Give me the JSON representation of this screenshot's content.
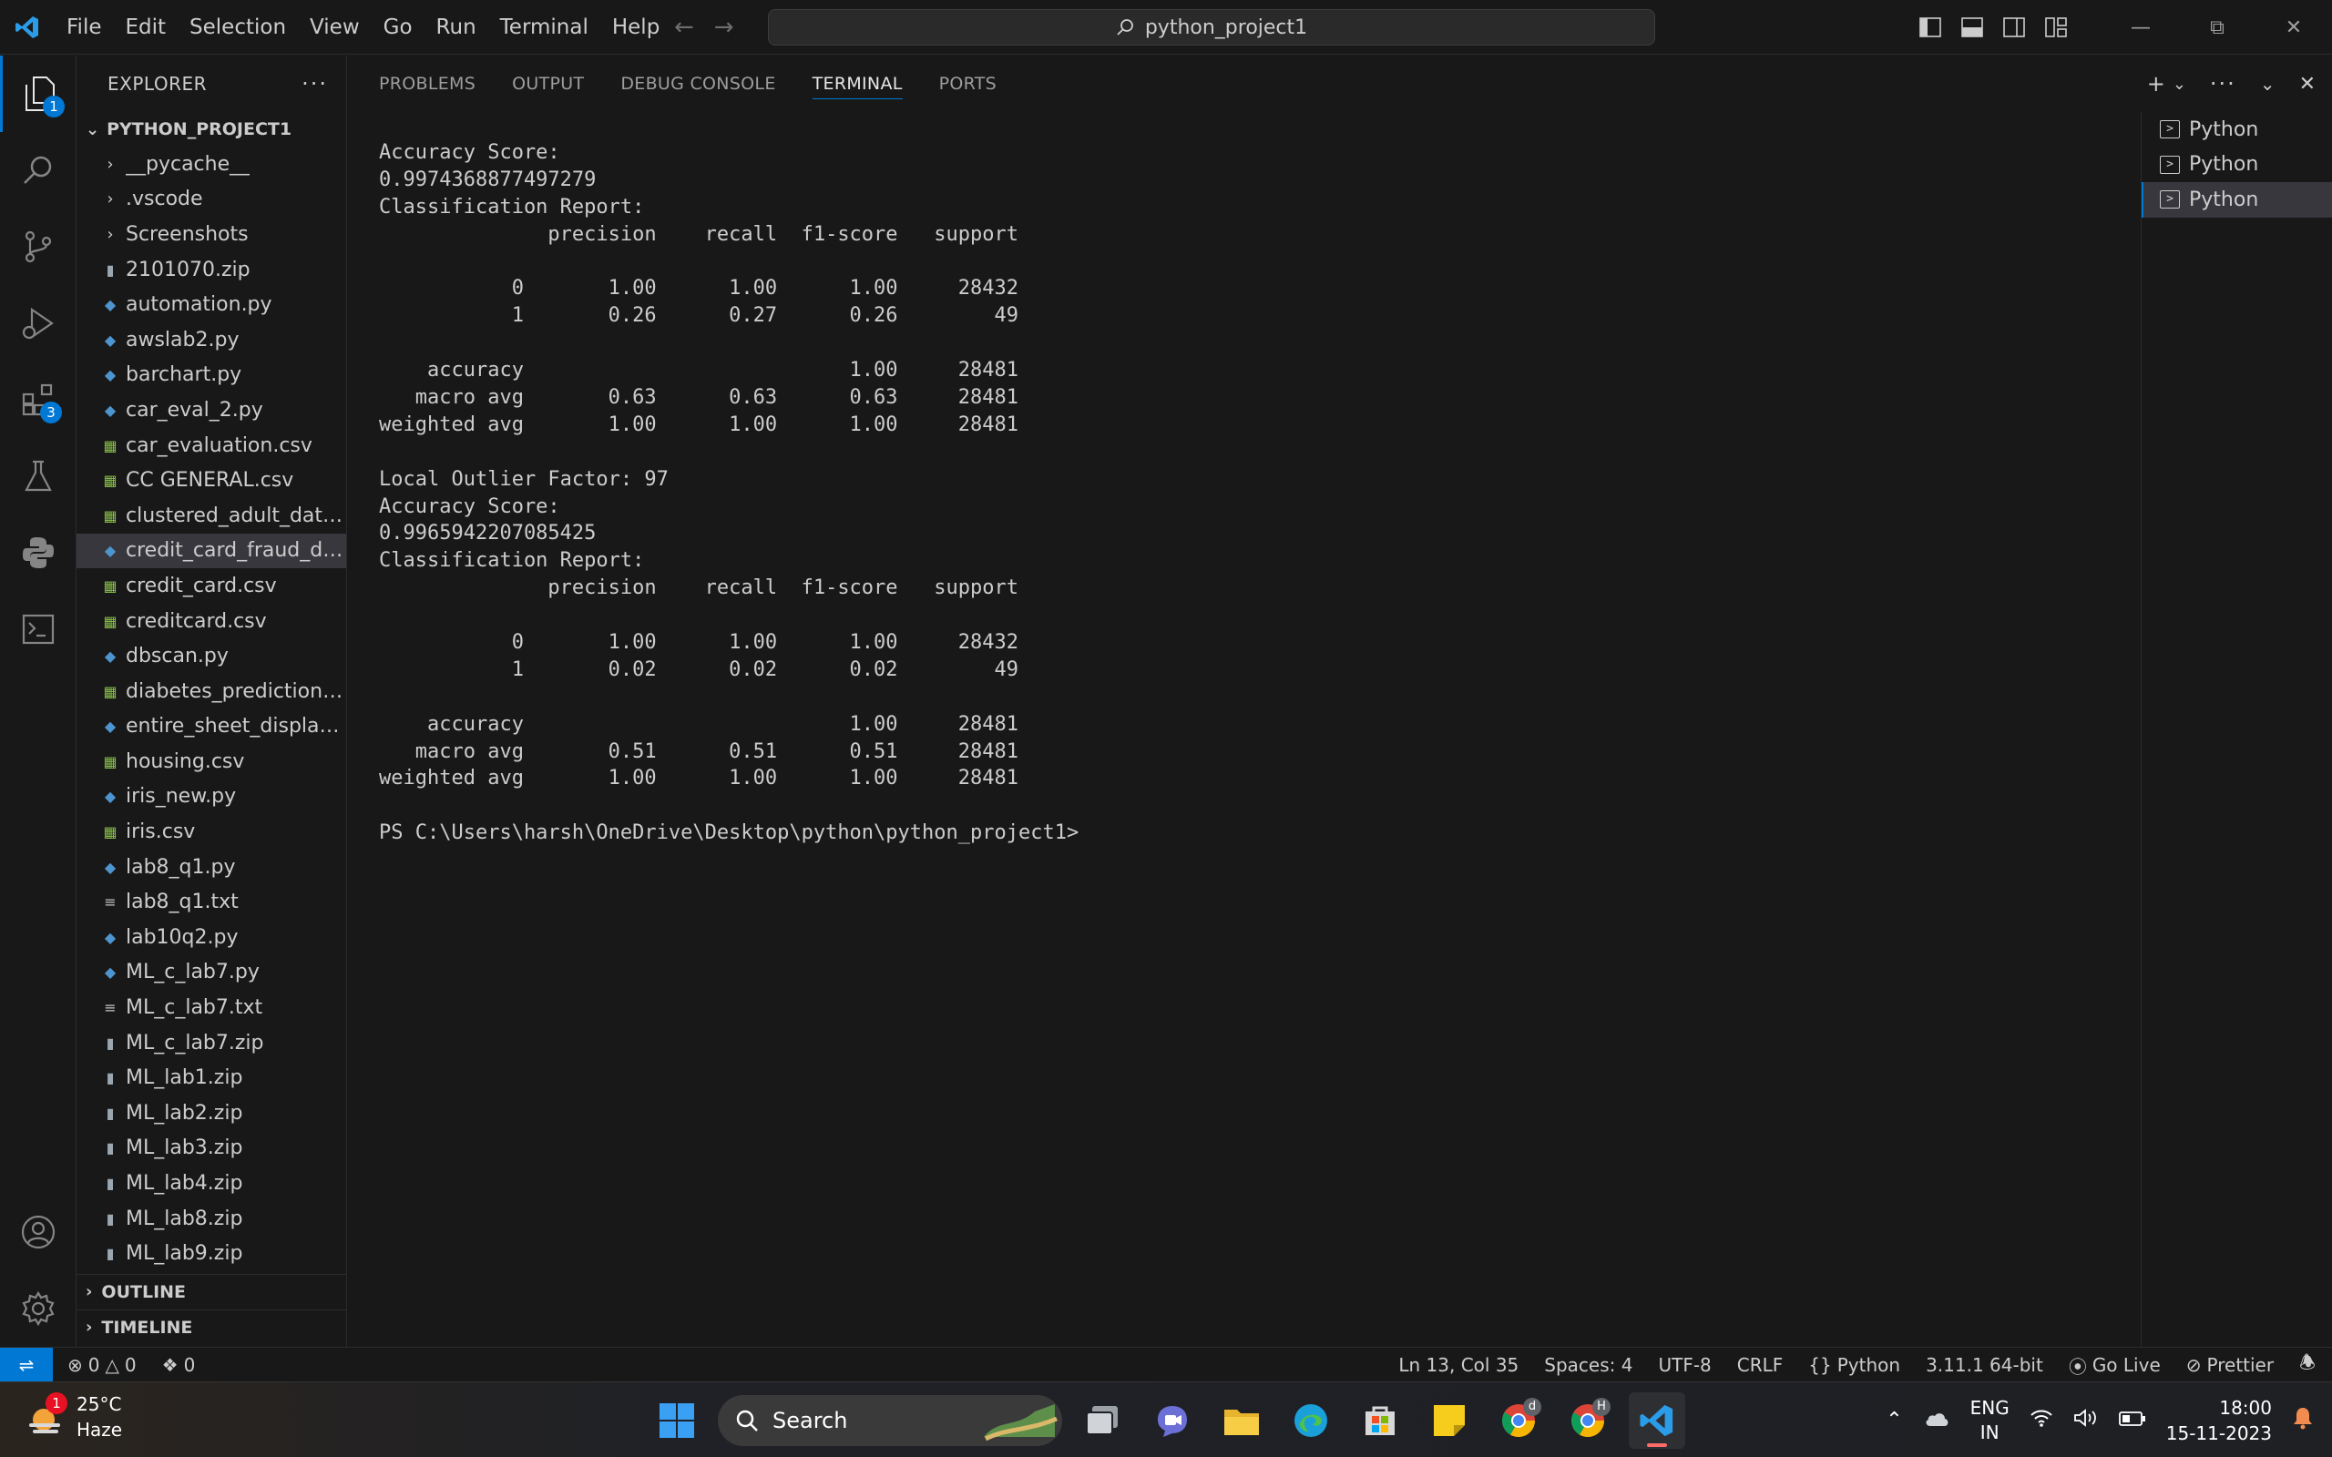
{
  "titlebar": {
    "menu": [
      "File",
      "Edit",
      "Selection",
      "View",
      "Go",
      "Run",
      "Terminal",
      "Help"
    ],
    "command_center": "python_project1"
  },
  "activity_bar": {
    "explorer_badge": "1",
    "extensions_badge": "3"
  },
  "sidebar": {
    "title": "EXPLORER",
    "project": "PYTHON_PROJECT1",
    "items": [
      {
        "name": "__pycache__",
        "type": "folder"
      },
      {
        "name": ".vscode",
        "type": "folder"
      },
      {
        "name": "Screenshots",
        "type": "folder"
      },
      {
        "name": "2101070.zip",
        "type": "zip"
      },
      {
        "name": "automation.py",
        "type": "py"
      },
      {
        "name": "awslab2.py",
        "type": "py"
      },
      {
        "name": "barchart.py",
        "type": "py"
      },
      {
        "name": "car_eval_2.py",
        "type": "py"
      },
      {
        "name": "car_evaluation.csv",
        "type": "csv"
      },
      {
        "name": "CC GENERAL.csv",
        "type": "csv"
      },
      {
        "name": "clustered_adult_data....",
        "type": "csv"
      },
      {
        "name": "credit_card_fraud_det...",
        "type": "py",
        "selected": true
      },
      {
        "name": "credit_card.csv",
        "type": "csv"
      },
      {
        "name": "creditcard.csv",
        "type": "csv"
      },
      {
        "name": "dbscan.py",
        "type": "py"
      },
      {
        "name": "diabetes_prediction_d...",
        "type": "csv"
      },
      {
        "name": "entire_sheet_display.py",
        "type": "py"
      },
      {
        "name": "housing.csv",
        "type": "csv"
      },
      {
        "name": "iris_new.py",
        "type": "py"
      },
      {
        "name": "iris.csv",
        "type": "csv"
      },
      {
        "name": "lab8_q1.py",
        "type": "py"
      },
      {
        "name": "lab8_q1.txt",
        "type": "txt"
      },
      {
        "name": "lab10q2.py",
        "type": "py"
      },
      {
        "name": "ML_c_lab7.py",
        "type": "py"
      },
      {
        "name": "ML_c_lab7.txt",
        "type": "txt"
      },
      {
        "name": "ML_c_lab7.zip",
        "type": "zip"
      },
      {
        "name": "ML_lab1.zip",
        "type": "zip"
      },
      {
        "name": "ML_lab2.zip",
        "type": "zip"
      },
      {
        "name": "ML_lab3.zip",
        "type": "zip"
      },
      {
        "name": "ML_lab4.zip",
        "type": "zip"
      },
      {
        "name": "ML_lab8.zip",
        "type": "zip"
      },
      {
        "name": "ML_lab9.zip",
        "type": "zip"
      }
    ],
    "outline": "OUTLINE",
    "timeline": "TIMELINE"
  },
  "panel": {
    "tabs": [
      "PROBLEMS",
      "OUTPUT",
      "DEBUG CONSOLE",
      "TERMINAL",
      "PORTS"
    ],
    "active_tab": "TERMINAL",
    "terminal_lines": [
      "Accuracy Score:",
      "0.9974368877497279",
      "Classification Report:",
      "              precision    recall  f1-score   support",
      "",
      "           0       1.00      1.00      1.00     28432",
      "           1       0.26      0.27      0.26        49",
      "",
      "    accuracy                           1.00     28481",
      "   macro avg       0.63      0.63      0.63     28481",
      "weighted avg       1.00      1.00      1.00     28481",
      "",
      "Local Outlier Factor: 97",
      "Accuracy Score:",
      "0.9965942207085425",
      "Classification Report:",
      "              precision    recall  f1-score   support",
      "",
      "           0       1.00      1.00      1.00     28432",
      "           1       0.02      0.02      0.02        49",
      "",
      "    accuracy                           1.00     28481",
      "   macro avg       0.51      0.51      0.51     28481",
      "weighted avg       1.00      1.00      1.00     28481",
      "",
      "PS C:\\Users\\harsh\\OneDrive\\Desktop\\python\\python_project1>"
    ],
    "terminals": [
      "Python",
      "Python",
      "Python"
    ]
  },
  "statusbar": {
    "errors": "0",
    "warnings": "0",
    "ports": "0",
    "position": "Ln 13, Col 35",
    "spaces": "Spaces: 4",
    "encoding": "UTF-8",
    "eol": "CRLF",
    "language": "Python",
    "interpreter": "3.11.1 64-bit",
    "golive": "Go Live",
    "prettier": "Prettier"
  },
  "taskbar": {
    "weather_badge": "1",
    "temperature": "25°C",
    "condition": "Haze",
    "search": "Search",
    "chrome_badge_1": "d",
    "chrome_badge_2": "H",
    "lang_1": "ENG",
    "lang_2": "IN",
    "time": "18:00",
    "date": "15-11-2023"
  },
  "colors": {
    "accent": "#0078d4",
    "background": "#181818"
  }
}
